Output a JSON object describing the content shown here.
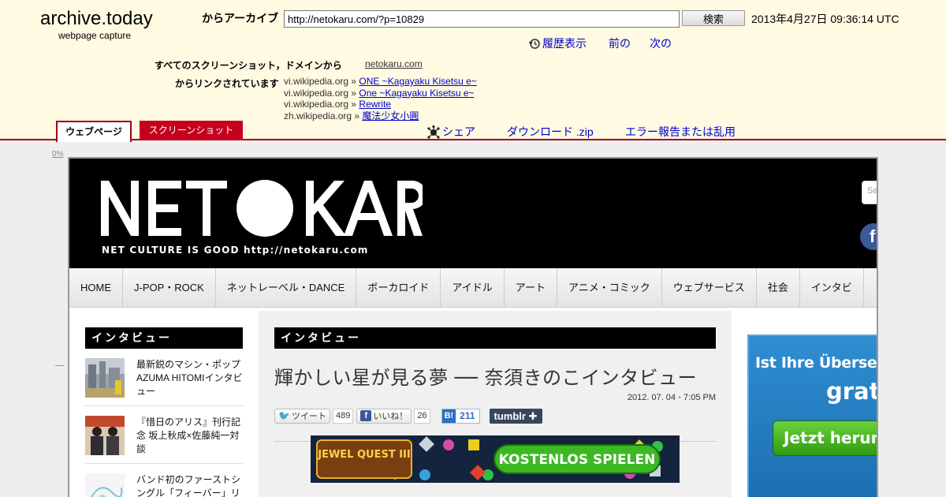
{
  "archive": {
    "logo_title": "archive.today",
    "logo_sub": "webpage capture",
    "archive_label": "からアーカイブ",
    "url_value": "http://netokaru.com/?p=10829",
    "search_label": "検索",
    "timestamp": "2013年4月27日 09:36:14 UTC",
    "history_label": "履歴表示",
    "prev_label": "前の",
    "next_label": "次の",
    "domain_label": "すべてのスクリーンショット，ドメインから",
    "domain_link": "netokaru.com",
    "linked_label": "からリンクされています",
    "linked_from": [
      {
        "source": "vi.wikipedia.org",
        "title": "ONE ~Kagayaku Kisetsu e~"
      },
      {
        "source": "vi.wikipedia.org",
        "title": "One ~Kagayaku Kisetsu e~"
      },
      {
        "source": "vi.wikipedia.org",
        "title": "Rewrite"
      },
      {
        "source": "zh.wikipedia.org",
        "title": "魔法少女小圓"
      }
    ],
    "separator": "»",
    "tab_webpage": "ウェブページ",
    "tab_screenshot": "スクリーンショット",
    "share_label": "シェア",
    "download_label": "ダウンロード .zip",
    "report_label": "エラー報告または乱用",
    "zoom_label": "0%",
    "accent_color": "#a0001c"
  },
  "site": {
    "logo_text": "NETOKARU",
    "tagline": "NET CULTURE IS GOOD   http://netokaru.com",
    "search_placeholder": "Se",
    "nav": [
      "HOME",
      "J-POP・ROCK",
      "ネットレーベル・DANCE",
      "ボーカロイド",
      "アイドル",
      "アート",
      "アニメ・コミック",
      "ウェブサービス",
      "社会",
      "インタビ"
    ],
    "sidebar_heading": "インタビュー",
    "sidebar_items": [
      {
        "text": "最新鋭のマシン・ポップAZUMA HITOMIインタビュー"
      },
      {
        "text": "『惜日のアリス』刊行記念 坂上秋成×佐藤純一対談"
      },
      {
        "text": "バンド初のファーストシングル「フィーバー」リ"
      }
    ],
    "article": {
      "category": "インタビュー",
      "title": "輝かしい星が見る夢 ── 奈須きのこインタビュー",
      "date": "2012. 07. 04",
      "time": "7:05 PM",
      "tweet_label": "ツイート",
      "tweet_count": "489",
      "like_label": "いいね！",
      "like_count": "26",
      "hatena_count": "211",
      "tumblr_label": "tumblr"
    },
    "ad_banner": {
      "game": "JEWEL QUEST III",
      "cta": "KOSTENLOS SPIELEN"
    },
    "right_ad": {
      "line1": "Ist Ihre Übersetzu",
      "line2": "grat",
      "button": "Jetzt herun"
    }
  }
}
